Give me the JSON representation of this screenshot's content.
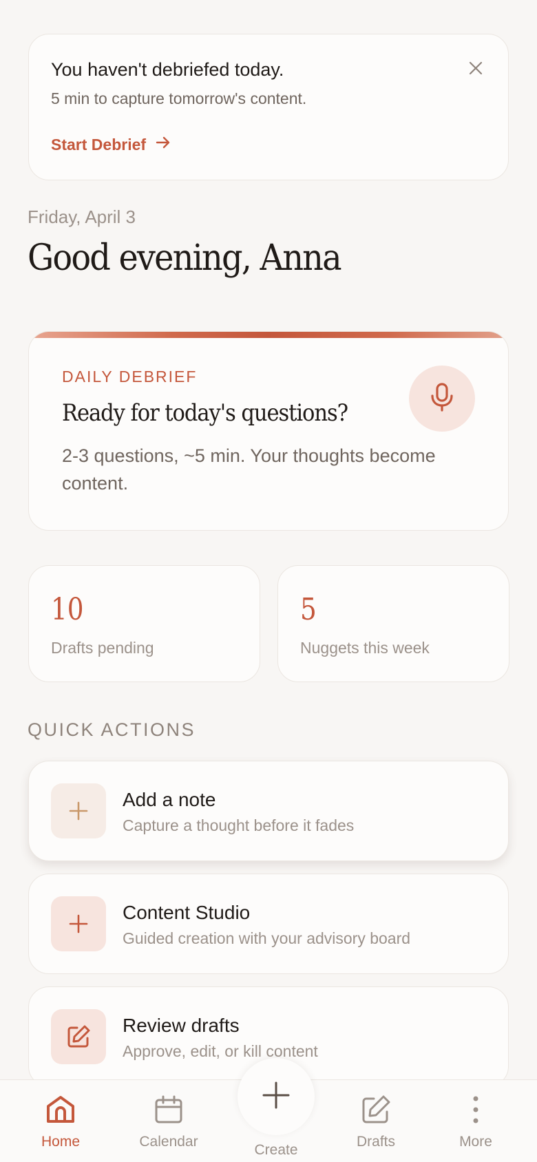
{
  "banner": {
    "title": "You haven't debriefed today.",
    "subtitle": "5 min to capture tomorrow's content.",
    "cta_label": "Start Debrief"
  },
  "header": {
    "date": "Friday, April 3",
    "greeting": "Good evening, Anna"
  },
  "debrief": {
    "label": "DAILY DEBRIEF",
    "question": "Ready for today's questions?",
    "description": "2-3 questions, ~5 min. Your thoughts become content."
  },
  "stats": [
    {
      "value": "10",
      "label": "Drafts pending"
    },
    {
      "value": "5",
      "label": "Nuggets this week"
    }
  ],
  "quick_actions": {
    "heading": "QUICK ACTIONS",
    "items": [
      {
        "title": "Add a note",
        "subtitle": "Capture a thought before it fades",
        "icon": "plus-icon"
      },
      {
        "title": "Content Studio",
        "subtitle": "Guided creation with your advisory board",
        "icon": "plus-icon"
      },
      {
        "title": "Review drafts",
        "subtitle": "Approve, edit, or kill content",
        "icon": "edit-icon"
      }
    ]
  },
  "nav": {
    "items": [
      {
        "label": "Home",
        "icon": "home-icon",
        "active": true
      },
      {
        "label": "Calendar",
        "icon": "calendar-icon"
      },
      {
        "label": "Create",
        "icon": "plus-icon"
      },
      {
        "label": "Drafts",
        "icon": "edit-icon"
      },
      {
        "label": "More",
        "icon": "more-vertical-icon"
      }
    ]
  },
  "colors": {
    "accent": "#c4573b",
    "background": "#f8f6f4",
    "card": "#fdfcfb",
    "muted_text": "#9b918a"
  }
}
